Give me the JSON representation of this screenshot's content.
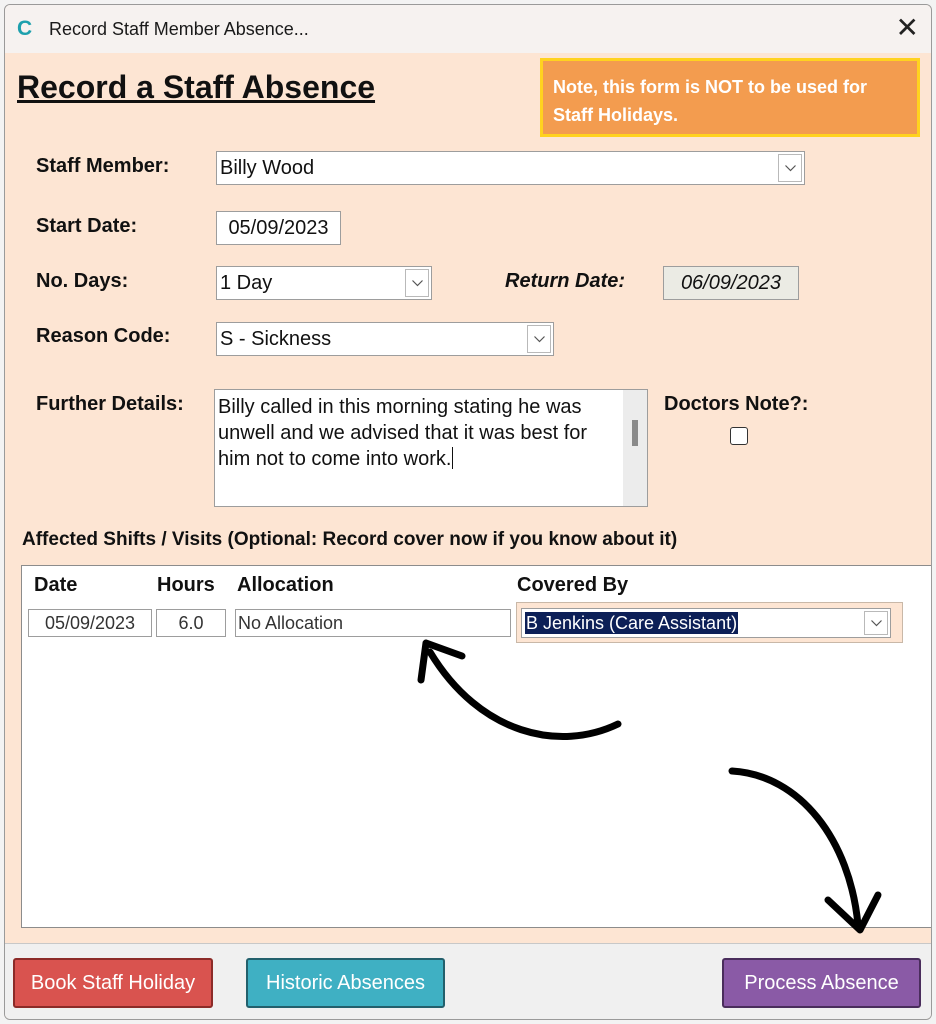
{
  "window": {
    "title": "Record Staff Member Absence...",
    "close_glyph": "✕",
    "app_icon": "C"
  },
  "form": {
    "heading": "Record a Staff Absence",
    "note": "Note, this form is NOT to be used for Staff Holidays.",
    "staff_member": {
      "label": "Staff Member:",
      "value": "Billy Wood"
    },
    "start_date": {
      "label": "Start Date:",
      "value": "05/09/2023"
    },
    "no_days": {
      "label": "No. Days:",
      "value": "1 Day"
    },
    "return_date": {
      "label": "Return Date:",
      "value": "06/09/2023"
    },
    "reason_code": {
      "label": "Reason Code:",
      "value": "S - Sickness"
    },
    "further_details": {
      "label": "Further Details:",
      "value": "Billy called in this morning stating he was unwell and we advised that it was best for him not to come into work."
    },
    "doctors_note": {
      "label": "Doctors Note?:",
      "checked": false
    }
  },
  "affected": {
    "section_title": "Affected Shifts / Visits (Optional: Record cover now if you know about it)",
    "columns": [
      "Date",
      "Hours",
      "Allocation",
      "Covered By"
    ],
    "rows": [
      {
        "date": "05/09/2023",
        "hours": "6.0",
        "allocation": "No Allocation",
        "covered_by": "B Jenkins (Care Assistant)"
      }
    ]
  },
  "buttons": {
    "book_holiday": "Book Staff Holiday",
    "historic": "Historic Absences",
    "process": "Process Absence"
  },
  "colors": {
    "form_bg": "#fde5d3",
    "note_bg": "#f39c4f",
    "note_border": "#ffd21f",
    "book_holiday": "#d9534f",
    "historic": "#3fb0c3",
    "process": "#8a5aa6",
    "app_icon": "#1da0ad"
  },
  "icons": [
    "chevron-down-icon",
    "close-icon",
    "app-logo-icon",
    "arrow-annotation-icon"
  ]
}
